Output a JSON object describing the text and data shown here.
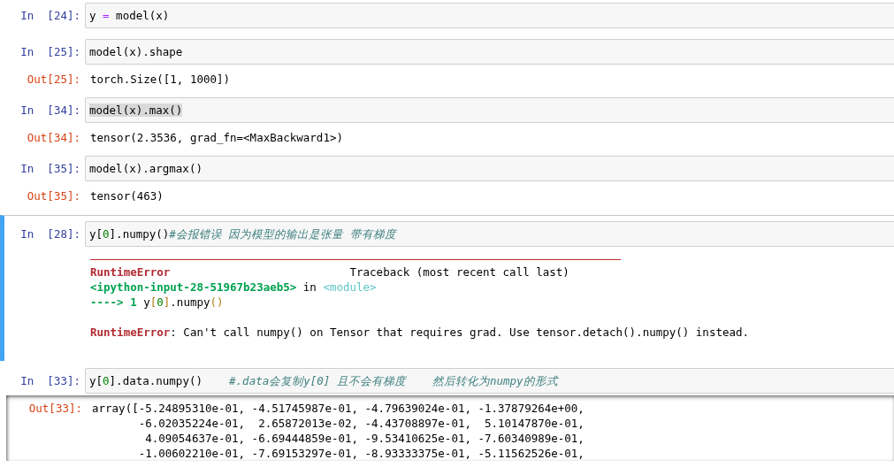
{
  "cells": [
    {
      "prompt": "In  [24]:",
      "selected": false,
      "text_selected": false,
      "input": [
        {
          "kind": "plain",
          "text": "y "
        },
        {
          "kind": "op",
          "text": "="
        },
        {
          "kind": "plain",
          "text": " model(x)"
        }
      ]
    },
    {
      "prompt": "In  [25]:",
      "selected": false,
      "text_selected": false,
      "input": [
        {
          "kind": "plain",
          "text": "model(x).shape"
        }
      ],
      "outputs": [
        {
          "kind": "result",
          "prompt": "Out[25]:",
          "lines": [
            [
              {
                "kind": "plain",
                "text": "torch.Size([1, 1000])"
              }
            ]
          ]
        }
      ]
    },
    {
      "prompt": "In  [34]:",
      "selected": false,
      "text_selected": true,
      "input": [
        {
          "kind": "plain",
          "text": "model(x).max()"
        }
      ],
      "outputs": [
        {
          "kind": "result",
          "prompt": "Out[34]:",
          "lines": [
            [
              {
                "kind": "plain",
                "text": "tensor(2.3536, grad_fn=<MaxBackward1>)"
              }
            ]
          ]
        }
      ]
    },
    {
      "prompt": "In  [35]:",
      "selected": false,
      "text_selected": false,
      "input": [
        {
          "kind": "plain",
          "text": "model(x).argmax()"
        }
      ],
      "outputs": [
        {
          "kind": "result",
          "prompt": "Out[35]:",
          "lines": [
            [
              {
                "kind": "plain",
                "text": "tensor(463)"
              }
            ]
          ]
        }
      ]
    },
    {
      "prompt": "In  [28]:",
      "selected": true,
      "text_selected": false,
      "input": [
        {
          "kind": "plain",
          "text": "y["
        },
        {
          "kind": "num",
          "text": "0"
        },
        {
          "kind": "plain",
          "text": "].numpy()"
        },
        {
          "kind": "comment",
          "text": "#会报错误 因为模型的输出是张量 带有梯度"
        }
      ],
      "outputs": [
        {
          "kind": "error",
          "lines": [
            [
              {
                "kind": "err",
                "text": "RuntimeError"
              },
              {
                "kind": "plain",
                "text": "                           Traceback (most recent call last)"
              }
            ],
            [
              {
                "kind": "loc",
                "text": "<ipython-input-28-51967b23aeb5>"
              },
              {
                "kind": "plain",
                "text": " in "
              },
              {
                "kind": "mod",
                "text": "<module>"
              }
            ],
            [
              {
                "kind": "loc",
                "text": "----> 1 "
              },
              {
                "kind": "plain",
                "text": "y"
              },
              {
                "kind": "brown",
                "text": "["
              },
              {
                "kind": "num",
                "text": "0"
              },
              {
                "kind": "brown",
                "text": "]"
              },
              {
                "kind": "plain",
                "text": ".numpy"
              },
              {
                "kind": "brown",
                "text": "()"
              }
            ],
            [
              {
                "kind": "err",
                "text": "RuntimeError"
              },
              {
                "kind": "plain",
                "text": ": Can't call numpy() on Tensor that requires grad. Use tensor.detach().numpy() instead."
              }
            ]
          ]
        }
      ]
    },
    {
      "prompt": "In  [33]:",
      "selected": false,
      "text_selected": false,
      "input": [
        {
          "kind": "plain",
          "text": "y["
        },
        {
          "kind": "num",
          "text": "0"
        },
        {
          "kind": "plain",
          "text": "].data.numpy()    "
        },
        {
          "kind": "comment",
          "text": "#.data会复制y[0] 且不会有梯度    然后转化为numpy的形式"
        }
      ],
      "outputs": [
        {
          "kind": "result",
          "prompt": "Out[33]:",
          "scrolled": true,
          "lines": [
            [
              {
                "kind": "plain",
                "text": "array([-5.24895310e-01, -4.51745987e-01, -4.79639024e-01, -1.37879264e+00,"
              }
            ],
            [
              {
                "kind": "plain",
                "text": "       -6.02035224e-01,  2.65872013e-02, -4.43708897e-01,  5.10147870e-01,"
              }
            ],
            [
              {
                "kind": "plain",
                "text": "        4.09054637e-01, -6.69444859e-01, -9.53410625e-01, -7.60340989e-01,"
              }
            ],
            [
              {
                "kind": "plain",
                "text": "       -1.00602210e-01, -7.69153297e-01, -8.93333375e-01, -5.11562526e-01,"
              }
            ]
          ]
        }
      ]
    }
  ]
}
